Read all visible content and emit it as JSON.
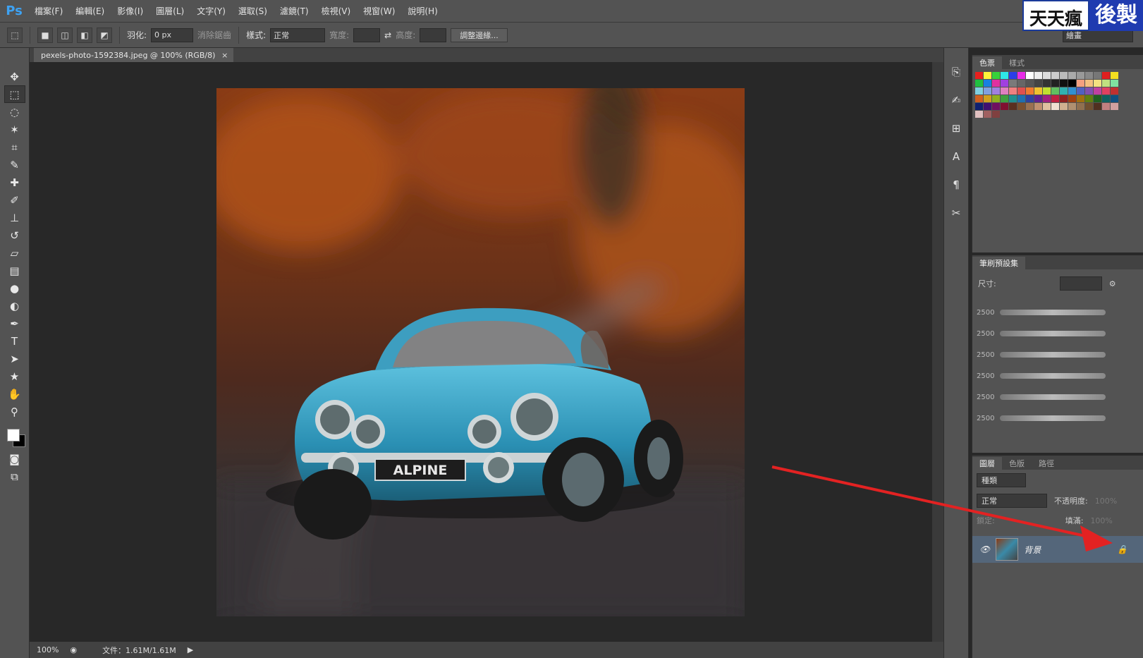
{
  "app": {
    "logo": "Ps"
  },
  "menu": [
    "檔案(F)",
    "編輯(E)",
    "影像(I)",
    "圖層(L)",
    "文字(Y)",
    "選取(S)",
    "濾鏡(T)",
    "檢視(V)",
    "視窗(W)",
    "說明(H)"
  ],
  "watermark": {
    "part1": "天天瘋",
    "part2": "後製"
  },
  "options": {
    "feather_label": "羽化:",
    "feather_value": "0 px",
    "antialias_label": "消除鋸齒",
    "style_label": "樣式:",
    "style_value": "正常",
    "width_label": "寬度:",
    "height_label": "高度:",
    "refine_button": "調整邊緣...",
    "workspace_value": "繪畫"
  },
  "document": {
    "tab_title": "pexels-photo-1592384.jpeg @ 100% (RGB/8)",
    "close_symbol": "×"
  },
  "status": {
    "zoom": "100%",
    "doc_size": "文件：1.61M/1.61M"
  },
  "panels": {
    "swatches_tabs": [
      "色票",
      "樣式"
    ],
    "brush_title": "筆刷預設集",
    "brush_size_label": "尺寸:",
    "brush_size_values": [
      "2500",
      "2500",
      "2500",
      "2500",
      "2500",
      "2500"
    ],
    "layers_tabs": [
      "圖層",
      "色版",
      "路徑"
    ],
    "kind_value": "種類",
    "blend_value": "正常",
    "opacity_label": "不透明度:",
    "opacity_value": "100%",
    "lock_label": "鎖定:",
    "fill_label": "填滿:",
    "fill_value": "100%",
    "layer_name": "背景"
  },
  "photo": {
    "plate_text": "ALPINE"
  },
  "colors": {
    "accent_layer": "#54667a",
    "arrow": "#e32222",
    "car": "#2a8fb3"
  }
}
